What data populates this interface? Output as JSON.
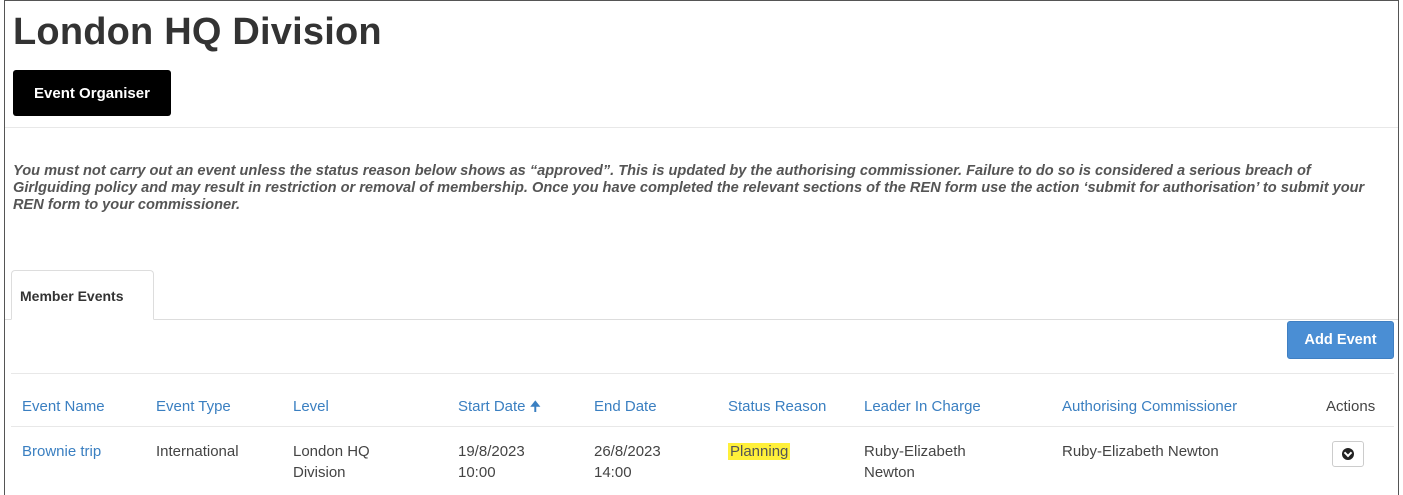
{
  "page": {
    "title": "London HQ Division",
    "organiser_button": "Event Organiser",
    "notice": "You must not carry out an event unless the status reason below shows as “approved”.  This is updated by the authorising commissioner.  Failure to do so is considered a serious breach of Girlguiding policy and may result in restriction or removal of membership.  Once you have completed the relevant sections of the REN form use the action ‘submit for authorisation’ to submit your REN form to your commissioner."
  },
  "tabs": [
    {
      "label": "Member Events",
      "active": true
    }
  ],
  "toolbar": {
    "add_event_label": "Add Event"
  },
  "table": {
    "headers": {
      "event_name": "Event Name",
      "event_type": "Event Type",
      "level": "Level",
      "start_date": "Start Date",
      "end_date": "End Date",
      "status_reason": "Status Reason",
      "leader_in_charge": "Leader In Charge",
      "authorising_commissioner": "Authorising Commissioner",
      "actions": "Actions"
    },
    "sort": {
      "column": "start_date",
      "direction": "ascending",
      "icon": "arrow-up-icon"
    },
    "rows": [
      {
        "event_name": "Brownie trip",
        "event_type": "International",
        "level_line1": "London HQ",
        "level_line2": "Division",
        "start_date": "19/8/2023",
        "start_time": "10:00",
        "end_date": "26/8/2023",
        "end_time": "14:00",
        "status_reason": "Planning",
        "leader_line1": "Ruby-Elizabeth",
        "leader_line2": "Newton",
        "authorising_commissioner": "Ruby-Elizabeth Newton",
        "action_icon": "chevron-down-circle-icon"
      }
    ]
  },
  "colors": {
    "link": "#3a7fc1",
    "primary_button": "#4a8ed4",
    "highlight": "#fff03a",
    "organiser_button": "#000000"
  }
}
